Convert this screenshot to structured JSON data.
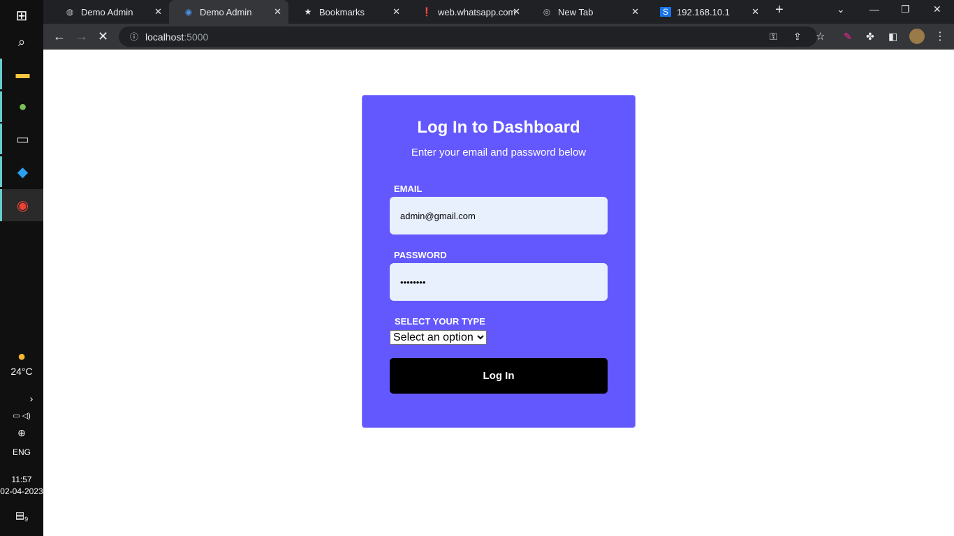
{
  "browser": {
    "tabs": [
      {
        "title": "Demo Admin",
        "icon": "globe-icon",
        "active": false
      },
      {
        "title": "Demo Admin",
        "icon": "chrome-app-icon",
        "active": true
      },
      {
        "title": "Bookmarks",
        "icon": "star-icon",
        "active": false
      },
      {
        "title": "web.whatsapp.com",
        "icon": "warning-icon",
        "active": false
      },
      {
        "title": "New Tab",
        "icon": "chrome-icon",
        "active": false
      },
      {
        "title": "192.168.10.1",
        "icon": "s-icon",
        "active": false
      }
    ],
    "url_host": "localhost",
    "url_port": ":5000"
  },
  "taskbar": {
    "temperature": "24°C",
    "language": "ENG",
    "time": "11:57",
    "date": "02-04-2023",
    "notifications": "9"
  },
  "login": {
    "title": "Log In to Dashboard",
    "subtitle": "Enter your email and password below",
    "email_label": "EMAIL",
    "email_value": "admin@gmail.com",
    "password_label": "PASSWORD",
    "password_value": "12345678",
    "type_label": "SELECT YOUR TYPE",
    "type_selected": "Select an option",
    "submit_label": "Log In",
    "accent": "#6358fe"
  }
}
